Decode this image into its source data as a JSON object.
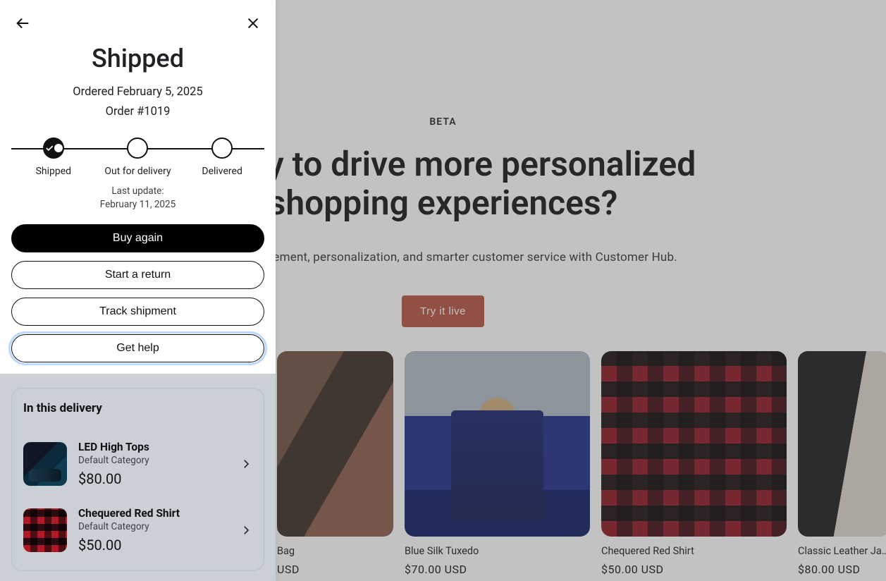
{
  "bg": {
    "beta": "BETA",
    "headline": "Ready to drive more personalized shopping experiences?",
    "subheadline": "Drive engagement, personalization, and smarter customer service with Customer Hub.",
    "cta": "Try it live",
    "products": [
      {
        "name": "Bag",
        "price": "USD"
      },
      {
        "name": "Blue Silk Tuxedo",
        "price": "$70.00 USD"
      },
      {
        "name": "Chequered Red Shirt",
        "price": "$50.00 USD"
      },
      {
        "name": "Classic Leather Jacket",
        "price": "$80.00 USD"
      }
    ]
  },
  "panel": {
    "title": "Shipped",
    "ordered_line": "Ordered February 5, 2025",
    "order_number_line": "Order #1019",
    "steps": [
      {
        "label": "Shipped",
        "done": true
      },
      {
        "label": "Out for delivery",
        "done": false
      },
      {
        "label": "Delivered",
        "done": false
      }
    ],
    "last_update_label": "Last update:",
    "last_update_value": "February 11, 2025",
    "buttons": {
      "buy_again": "Buy again",
      "start_return": "Start a return",
      "track": "Track shipment",
      "help": "Get help"
    },
    "delivery": {
      "title": "In this delivery",
      "items": [
        {
          "name": "LED High Tops",
          "category": "Default Category",
          "price": "$80.00"
        },
        {
          "name": "Chequered Red Shirt",
          "category": "Default Category",
          "price": "$50.00"
        }
      ]
    }
  }
}
